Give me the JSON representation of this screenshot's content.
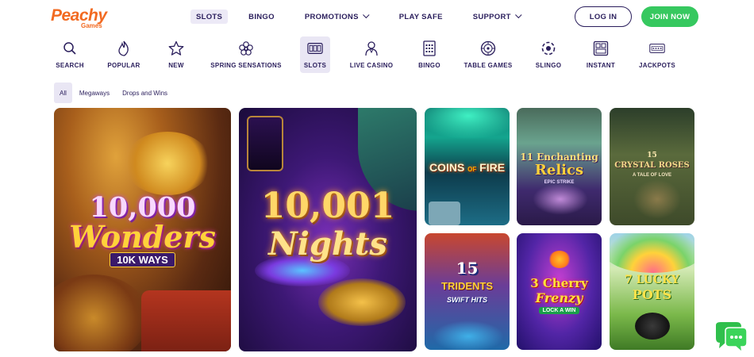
{
  "brand": {
    "logo_text": "Peachy",
    "logo_sub": "Games"
  },
  "topnav": {
    "items": [
      {
        "label": "SLOTS",
        "active": true,
        "dropdown": false
      },
      {
        "label": "BINGO",
        "active": false,
        "dropdown": false
      },
      {
        "label": "PROMOTIONS",
        "active": false,
        "dropdown": true
      },
      {
        "label": "PLAY SAFE",
        "active": false,
        "dropdown": false
      },
      {
        "label": "SUPPORT",
        "active": false,
        "dropdown": true
      }
    ],
    "login_label": "LOG IN",
    "join_label": "JOIN NOW"
  },
  "categories": [
    {
      "label": "SEARCH",
      "icon": "search-icon"
    },
    {
      "label": "POPULAR",
      "icon": "flame-icon"
    },
    {
      "label": "NEW",
      "icon": "star-icon"
    },
    {
      "label": "SPRING SENSATIONS",
      "icon": "flower-icon"
    },
    {
      "label": "SLOTS",
      "icon": "slot-machine-icon",
      "active": true
    },
    {
      "label": "LIVE CASINO",
      "icon": "dealer-icon"
    },
    {
      "label": "BINGO",
      "icon": "bingo-card-icon"
    },
    {
      "label": "TABLE GAMES",
      "icon": "roulette-icon"
    },
    {
      "label": "SLINGO",
      "icon": "slingo-ball-icon"
    },
    {
      "label": "INSTANT",
      "icon": "scratch-card-icon"
    },
    {
      "label": "JACKPOTS",
      "icon": "jackpot-icon"
    }
  ],
  "filters": [
    {
      "label": "All",
      "active": true
    },
    {
      "label": "Megaways",
      "active": false
    },
    {
      "label": "Drops and Wins",
      "active": false
    }
  ],
  "games": {
    "wonders": {
      "line1": "10,000",
      "line2": "Wonders",
      "line3": "10K WAYS"
    },
    "nights": {
      "line1": "10,001",
      "line2": "Nights"
    },
    "coins": {
      "line1": "COINS",
      "line2": "OF",
      "line3": "FIRE"
    },
    "relics": {
      "line1": "11 Enchanting",
      "line2": "Relics",
      "line3": "EPIC STRIKE"
    },
    "roses": {
      "line1": "15",
      "line2": "CRYSTAL ROSES",
      "line3": "A TALE OF LOVE"
    },
    "trident": {
      "line1": "15",
      "line2": "TRIDENTS",
      "line3": "SWIFT HITS"
    },
    "cherry": {
      "line1": "3 Cherry",
      "line2": "Frenzy",
      "line3": "LOCK A WIN"
    },
    "lucky": {
      "line1": "7 LUCKY",
      "line2": "POTS"
    }
  },
  "colors": {
    "brand_orange": "#f26a21",
    "join_green": "#36c85f",
    "text_navy": "#2a1e5c",
    "active_bg": "#e9e6f4",
    "chat_green": "#2fbf4c"
  }
}
